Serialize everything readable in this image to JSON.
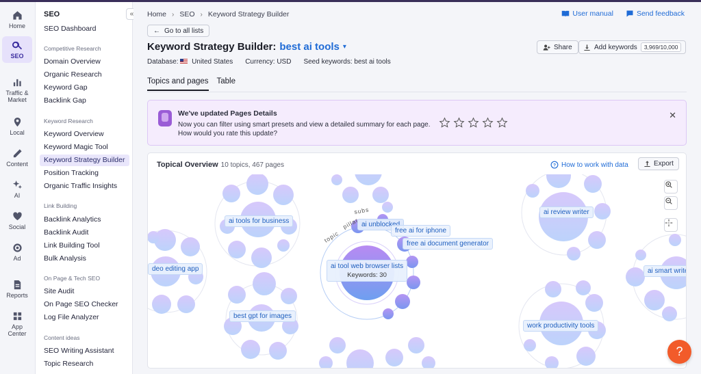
{
  "rail": [
    {
      "label": "Home",
      "icon": "home-icon"
    },
    {
      "label": "SEO",
      "icon": "seo-icon",
      "active": true
    },
    {
      "label": "Traffic &\nMarket",
      "icon": "bar-chart-icon"
    },
    {
      "label": "Local",
      "icon": "location-pin-icon"
    },
    {
      "label": "Content",
      "icon": "pen-icon"
    },
    {
      "label": "AI",
      "icon": "sparkle-icon"
    },
    {
      "label": "Social",
      "icon": "heart-icon"
    },
    {
      "label": "Ad",
      "icon": "target-icon"
    },
    {
      "label": "Reports",
      "icon": "document-icon"
    },
    {
      "label": "App\nCenter",
      "icon": "grid-icon"
    }
  ],
  "sidebar": {
    "heading": "SEO",
    "collapse_label": "«",
    "dashboard": "SEO Dashboard",
    "groups": [
      {
        "title": "Competitive Research",
        "items": [
          "Domain Overview",
          "Organic Research",
          "Keyword Gap",
          "Backlink Gap"
        ]
      },
      {
        "title": "Keyword Research",
        "items": [
          "Keyword Overview",
          "Keyword Magic Tool",
          "Keyword Strategy Builder",
          "Position Tracking",
          "Organic Traffic Insights"
        ]
      },
      {
        "title": "Link Building",
        "items": [
          "Backlink Analytics",
          "Backlink Audit",
          "Link Building Tool",
          "Bulk Analysis"
        ]
      },
      {
        "title": "On Page & Tech SEO",
        "items": [
          "Site Audit",
          "On Page SEO Checker",
          "Log File Analyzer"
        ]
      },
      {
        "title": "Content ideas",
        "items": [
          "SEO Writing Assistant",
          "Topic Research"
        ]
      }
    ],
    "active_item": "Keyword Strategy Builder"
  },
  "breadcrumb": {
    "home": "Home",
    "seo": "SEO",
    "current": "Keyword Strategy Builder"
  },
  "top_links": {
    "manual": "User manual",
    "feedback": "Send feedback"
  },
  "back_button": "Go to all lists",
  "page": {
    "title_prefix": "Keyword Strategy Builder:",
    "title_keyword": "best ai tools",
    "database_label": "Database:",
    "database_value": "United States",
    "currency": "Currency: USD",
    "seed": "Seed keywords: best ai tools",
    "share": "Share",
    "add_keywords": "Add keywords",
    "keyword_count": "3,969/10,000"
  },
  "tabs": [
    "Topics and pages",
    "Table"
  ],
  "notice": {
    "title": "We've updated Pages Details",
    "body": "Now you can filter using smart presets and view a detailed summary for each page.",
    "question": "How would you rate this update?",
    "stars": 5,
    "rating": 0,
    "close": "✕"
  },
  "overview": {
    "title": "Topical Overview",
    "subtitle": "10 topics, 467 pages",
    "how_to": "How to work with data",
    "export": "Export",
    "arc_labels": {
      "subs": "subs",
      "topic": "topic",
      "pillar": "pillar"
    },
    "labels": {
      "video": "deo editing app",
      "business": "ai tools for business",
      "unblocked": "ai unblocked",
      "iphone": "free ai for iphone",
      "docgen": "free ai document generator",
      "browser": "ai tool web browser lists",
      "keywords": "Keywords: 30",
      "review": "ai review writer",
      "gpt": "best gpt for images",
      "productivity": "work productivity tools",
      "smart": "ai smart write"
    }
  },
  "help": "?"
}
